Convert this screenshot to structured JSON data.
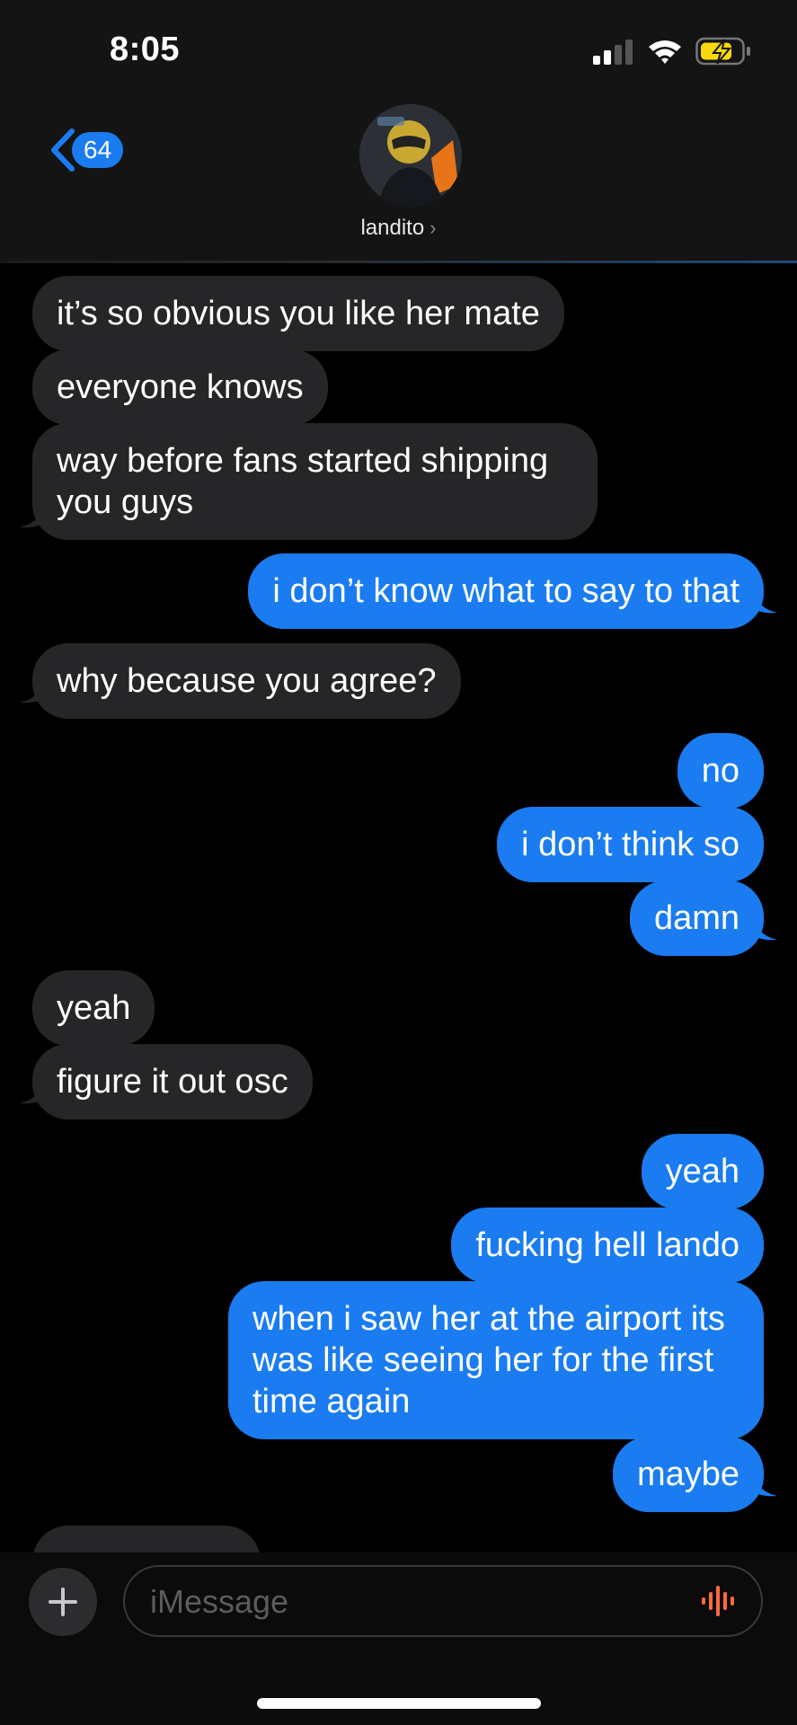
{
  "status_bar": {
    "time": "8:05"
  },
  "header": {
    "back_count": "64",
    "contact_name": "landito"
  },
  "messages": [
    {
      "side": "in",
      "text": "it’s so obvious you like her mate"
    },
    {
      "side": "in",
      "text": "everyone knows"
    },
    {
      "side": "in",
      "text": "way before fans started shipping you guys"
    },
    {
      "side": "out",
      "text": "i don’t know what to say to that"
    },
    {
      "side": "in",
      "text": "why because you agree?"
    },
    {
      "side": "out",
      "text": "no"
    },
    {
      "side": "out",
      "text": "i don’t think so"
    },
    {
      "side": "out",
      "text": "damn"
    },
    {
      "side": "in",
      "text": "yeah"
    },
    {
      "side": "in",
      "text": "figure it out osc"
    },
    {
      "side": "out",
      "text": "yeah"
    },
    {
      "side": "out",
      "text": "fucking hell lando"
    },
    {
      "side": "out",
      "text": "when i saw her at the airport its was like seeing her for the first time again"
    },
    {
      "side": "out",
      "text": "maybe"
    }
  ],
  "composer": {
    "placeholder": "iMessage"
  },
  "colors": {
    "outgoing": "#1a7cf0",
    "incoming": "#262628",
    "mic": "#ff6a3d",
    "battery": "#f5d90a"
  }
}
